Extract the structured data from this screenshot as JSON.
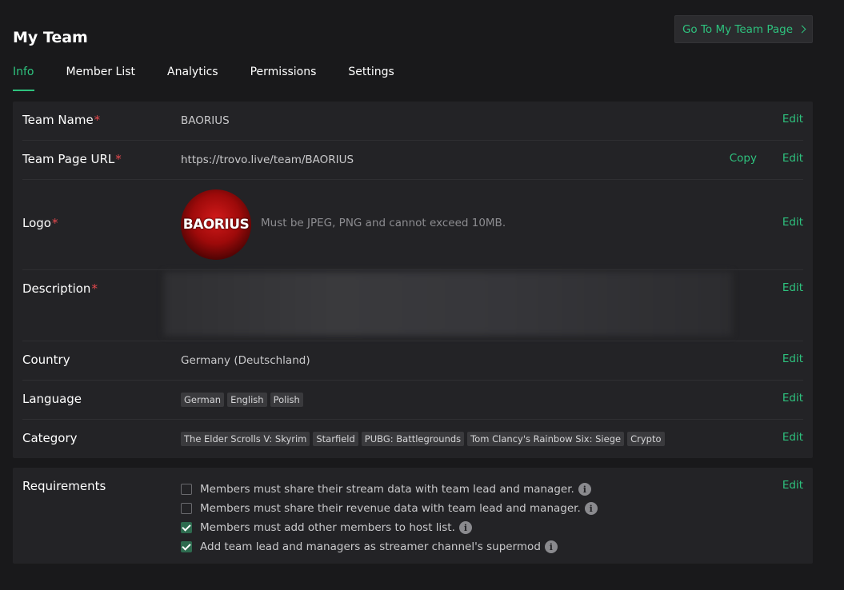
{
  "header": {
    "title": "My Team",
    "go_team_label": "Go To My Team Page"
  },
  "tabs": [
    {
      "label": "Info",
      "active": true
    },
    {
      "label": "Member List",
      "active": false
    },
    {
      "label": "Analytics",
      "active": false
    },
    {
      "label": "Permissions",
      "active": false
    },
    {
      "label": "Settings",
      "active": false
    }
  ],
  "info": {
    "edit_label": "Edit",
    "copy_label": "Copy",
    "required_mark": "*",
    "team_name": {
      "label": "Team Name",
      "value": "BAORIUS"
    },
    "team_url": {
      "label": "Team Page URL",
      "value": "https://trovo.live/team/BAORIUS"
    },
    "logo": {
      "label": "Logo",
      "logo_text": "BAORIUS",
      "hint": "Must be JPEG, PNG and cannot exceed 10MB."
    },
    "description": {
      "label": "Description"
    },
    "country": {
      "label": "Country",
      "value": "Germany (Deutschland)"
    },
    "language": {
      "label": "Language",
      "tags": [
        "German",
        "English",
        "Polish"
      ]
    },
    "category": {
      "label": "Category",
      "tags": [
        "The Elder Scrolls V: Skyrim",
        "Starfield",
        "PUBG: Battlegrounds",
        "Tom Clancy's Rainbow Six: Siege",
        "Crypto"
      ]
    }
  },
  "requirements": {
    "label": "Requirements",
    "edit_label": "Edit",
    "items": [
      {
        "text": "Members must share their stream data with team lead and manager.",
        "checked": false
      },
      {
        "text": "Members must share their revenue data with team lead and manager.",
        "checked": false
      },
      {
        "text": "Members must add other members to host list.",
        "checked": true
      },
      {
        "text": "Add team lead and managers as streamer channel's supermod",
        "checked": true
      }
    ]
  },
  "icons": {
    "info_glyph": "i"
  },
  "colors": {
    "accent": "#2ec27e",
    "required": "#e5484d",
    "background": "#19191b",
    "card": "#232326"
  }
}
